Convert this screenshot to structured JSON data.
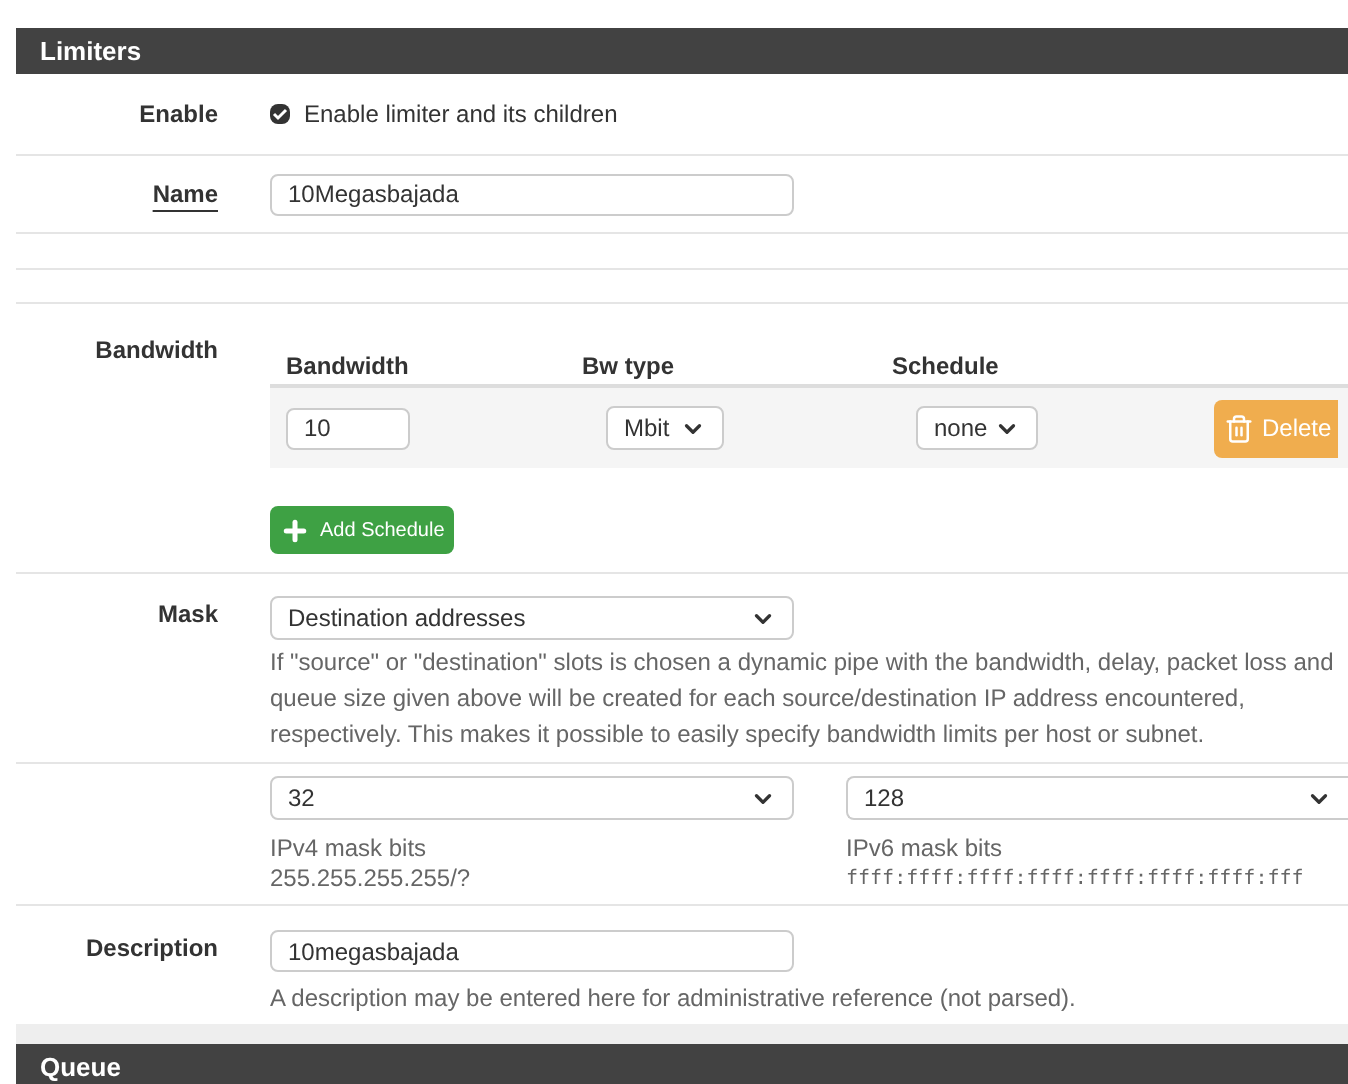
{
  "panel": {
    "title": "Limiters"
  },
  "enable": {
    "label": "Enable",
    "checkbox_label": "Enable limiter and its children",
    "checked": true
  },
  "name": {
    "label": "Name",
    "value": "10Megasbajada"
  },
  "bandwidth": {
    "label": "Bandwidth",
    "columns": [
      "Bandwidth",
      "Bw type",
      "Schedule"
    ],
    "rows": [
      {
        "bandwidth": "10",
        "bw_type": "Mbit",
        "schedule": "none",
        "delete": "Delete"
      }
    ],
    "add_button": "Add Schedule"
  },
  "mask": {
    "label": "Mask",
    "value": "Destination addresses",
    "help": "If \"source\" or \"destination\" slots is chosen a dynamic pipe with the bandwidth, delay, packet loss and queue size given above will be created for each source/destination IP address encountered, respectively. This makes it possible to easily specify bandwidth limits per host or subnet.",
    "ipv4": {
      "value": "32",
      "label": "IPv4 mask bits",
      "hint": "255.255.255.255/?"
    },
    "ipv6": {
      "value": "128",
      "label": "IPv6 mask bits",
      "hint": "ffff:ffff:ffff:ffff:ffff:ffff:ffff:fff"
    }
  },
  "description": {
    "label": "Description",
    "value": "10megasbajada",
    "help": "A description may be entered here for administrative reference (not parsed)."
  },
  "next_panel": {
    "title": "Queue"
  }
}
